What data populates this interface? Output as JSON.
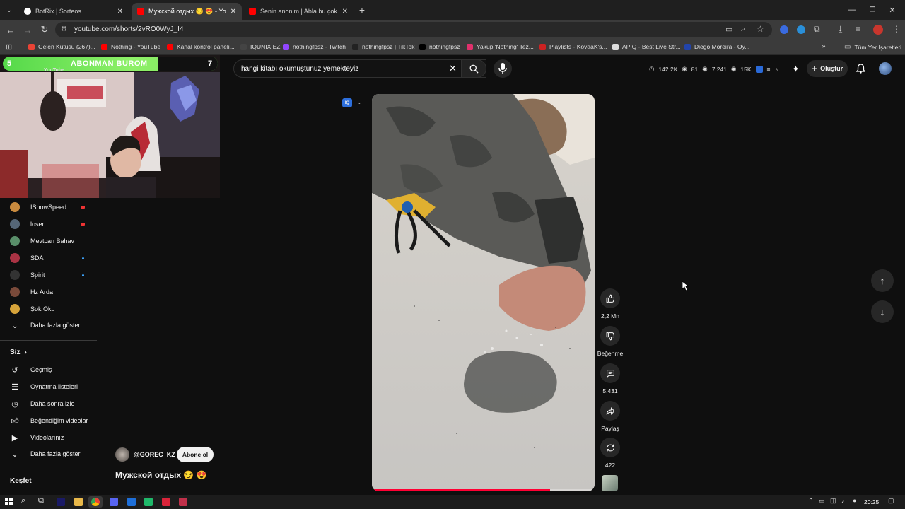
{
  "tabs": [
    {
      "title": "BotRix | Sorteos",
      "color": "#ffffff"
    },
    {
      "title": "Мужской отдых 😏 😍 - YouTube",
      "color": "#ff0000"
    },
    {
      "title": "Senin anonim | Abla bu çok küfürlü",
      "color": "#ff0000"
    }
  ],
  "url": "youtube.com/shorts/2vRO0WyJ_I4",
  "bookmarks": [
    {
      "label": "Gelen Kutusu (267)...",
      "color": "#ea4335"
    },
    {
      "label": "Nothing - YouTube",
      "color": "#ff0000"
    },
    {
      "label": "Kanal kontrol paneli...",
      "color": "#ff0000"
    },
    {
      "label": "IQUNIX EZ",
      "color": "#444444"
    },
    {
      "label": "nothingfpsz - Twitch",
      "color": "#9146ff"
    },
    {
      "label": "nothingfpsz | TikTok",
      "color": "#222222"
    },
    {
      "label": "nothingfpsz",
      "color": "#000000"
    },
    {
      "label": "Yakup 'Nothing' Tez...",
      "color": "#e1306c"
    },
    {
      "label": "Playlists - KovaaK's...",
      "color": "#cc2222"
    },
    {
      "label": "APIQ - Best Live Str...",
      "color": "#dddddd"
    },
    {
      "label": "Diego Moreira - Oy...",
      "color": "#2244aa"
    }
  ],
  "bookmarks_all": "Tüm Yer İşaretleri",
  "search": {
    "query": "hangi kitabı okumuştunuz yemekteyiz"
  },
  "header_stats": [
    "142.2K",
    "81",
    "7,241",
    "15K"
  ],
  "create_label": "Oluştur",
  "overlay": {
    "left_num": "5",
    "title": "ABONMAN BUROM",
    "right_num": "7",
    "sub": "YouTube"
  },
  "subscriptions": [
    {
      "name": "IShowSpeed",
      "live": true,
      "color": "#c98b3f"
    },
    {
      "name": "loser",
      "live": true,
      "color": "#556677"
    },
    {
      "name": "Mevtcan Bahav",
      "live": false,
      "color": "#5a8f6a"
    },
    {
      "name": "SDA",
      "live": false,
      "dot": true,
      "color": "#aa3344"
    },
    {
      "name": "Spirit",
      "live": false,
      "dot": true,
      "color": "#333333"
    },
    {
      "name": "Hz Arda",
      "live": false,
      "color": "#7a4a3a"
    },
    {
      "name": "Şok Oku",
      "live": false,
      "color": "#d6a33a"
    }
  ],
  "show_more": "Daha fazla göster",
  "you_section": {
    "title": "Siz",
    "items": [
      {
        "label": "Geçmiş",
        "icon": "history-icon"
      },
      {
        "label": "Oynatma listeleri",
        "icon": "playlists-icon"
      },
      {
        "label": "Daha sonra izle",
        "icon": "watch-later-icon"
      },
      {
        "label": "Beğendiğim videolar",
        "icon": "like-icon"
      },
      {
        "label": "Videolarınız",
        "icon": "your-videos-icon"
      }
    ],
    "show_more": "Daha fazla göster"
  },
  "explore_title": "Keşfet",
  "short": {
    "channel": "@GOREC_KZ",
    "subscribe": "Abone ol",
    "title": "Мужской отдых 😏 😍",
    "likes": "2,2 Mn",
    "dislike": "Beğenme",
    "comments": "5.431",
    "share": "Paylaş",
    "remix": "422",
    "progress": 0.8
  },
  "taskbar": {
    "time": "20:25"
  }
}
